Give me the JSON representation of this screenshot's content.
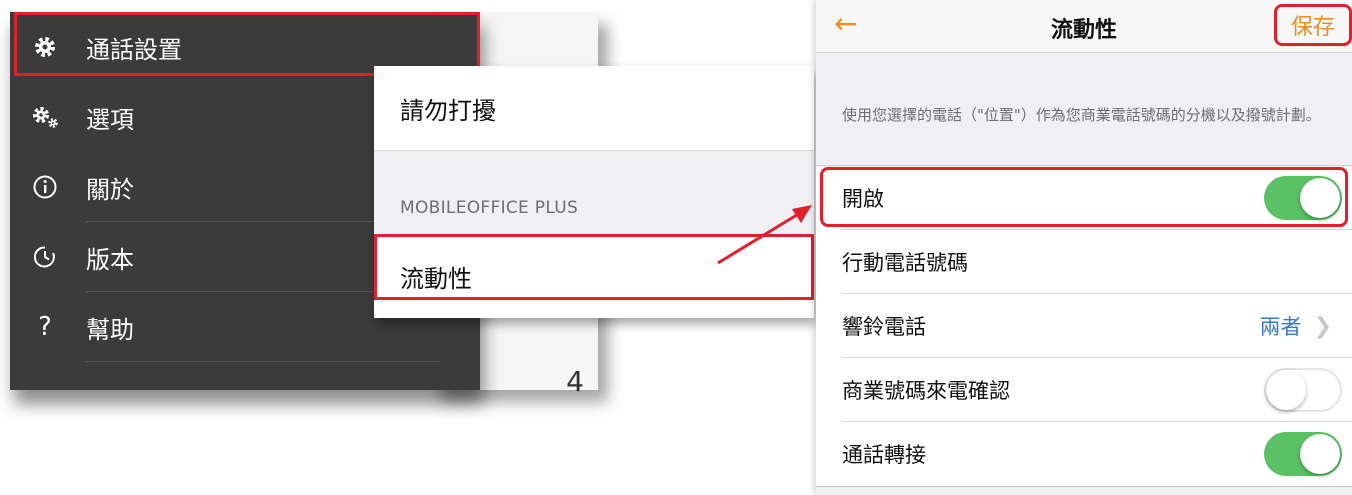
{
  "menu": {
    "items": [
      {
        "label": "通話設置",
        "icon": "gear-icon"
      },
      {
        "label": "選項",
        "icon": "gears-icon"
      },
      {
        "label": "關於",
        "icon": "info-icon"
      },
      {
        "label": "版本",
        "icon": "clock-icon"
      },
      {
        "label": "幫助",
        "icon": "question-icon"
      }
    ],
    "back_list_number": "4"
  },
  "middle": {
    "dnd_label": "請勿打擾",
    "section_header": "MOBILEOFFICE PLUS",
    "mobility_label": "流動性"
  },
  "mobility": {
    "back_icon": "←",
    "title": "流動性",
    "save_label": "保存",
    "description": "使用您選擇的電話（\"位置\"）作為您商業電話號碼的分機以及撥號計劃。",
    "rows": [
      {
        "label": "開啟",
        "toggle": true
      },
      {
        "label": "行動電話號碼"
      },
      {
        "label": "響鈴電話",
        "value": "兩者"
      },
      {
        "label": "商業號碼來電確認",
        "toggle": false
      },
      {
        "label": "通話轉接",
        "toggle": true
      }
    ]
  },
  "colors": {
    "accent": "#f28c1d",
    "highlight": "#e0202a",
    "toggle_on": "#5ac165",
    "link": "#3a78c9",
    "menu_bg": "#3b3b3b"
  }
}
